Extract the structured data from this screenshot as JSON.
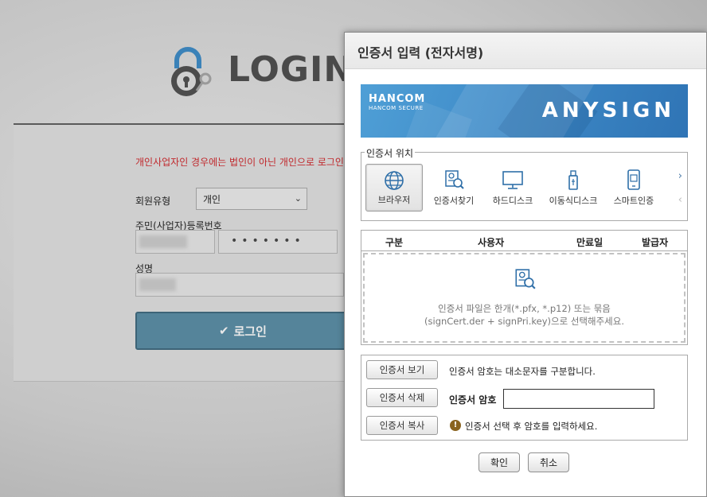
{
  "background": {
    "login_title": "LOGIN",
    "notice": "개인사업자인 경우에는 법인이 아닌 개인으로 로그인 바랍니다.",
    "member_type_label": "회원유형",
    "member_type_value": "개인",
    "reg_no_label": "주민(사업자)등록번호",
    "reg_no_masked": "•••••••",
    "name_label": "성명",
    "login_button": "로그인"
  },
  "dialog": {
    "title": "인증서 입력 (전자서명)",
    "banner": {
      "brand": "HANCOM",
      "brand_sub": "HANCOM SECURE",
      "product": "ANYSIGN"
    },
    "location": {
      "legend": "인증서 위치",
      "items": [
        {
          "label": "브라우저",
          "icon": "globe-icon",
          "selected": true
        },
        {
          "label": "인증서찾기",
          "icon": "cert-search-icon",
          "selected": false
        },
        {
          "label": "하드디스크",
          "icon": "monitor-icon",
          "selected": false
        },
        {
          "label": "이동식디스크",
          "icon": "usb-icon",
          "selected": false
        },
        {
          "label": "스마트인증",
          "icon": "smartphone-icon",
          "selected": false
        }
      ]
    },
    "table": {
      "columns": [
        "구분",
        "사용자",
        "만료일",
        "발급자"
      ],
      "drop_line1": "인증서 파일은 한개(*.pfx, *.p12) 또는 묶음",
      "drop_line2": "(signCert.der + signPri.key)으로 선택해주세요."
    },
    "buttons": {
      "view": "인증서 보기",
      "delete": "인증서 삭제",
      "copy": "인증서 복사",
      "ok": "확인",
      "cancel": "취소"
    },
    "password": {
      "note": "인증서 암호는 대소문자를 구분합니다.",
      "label": "인증서 암호",
      "value": "",
      "warning": "인증서 선택 후 암호를 입력하세요."
    }
  }
}
